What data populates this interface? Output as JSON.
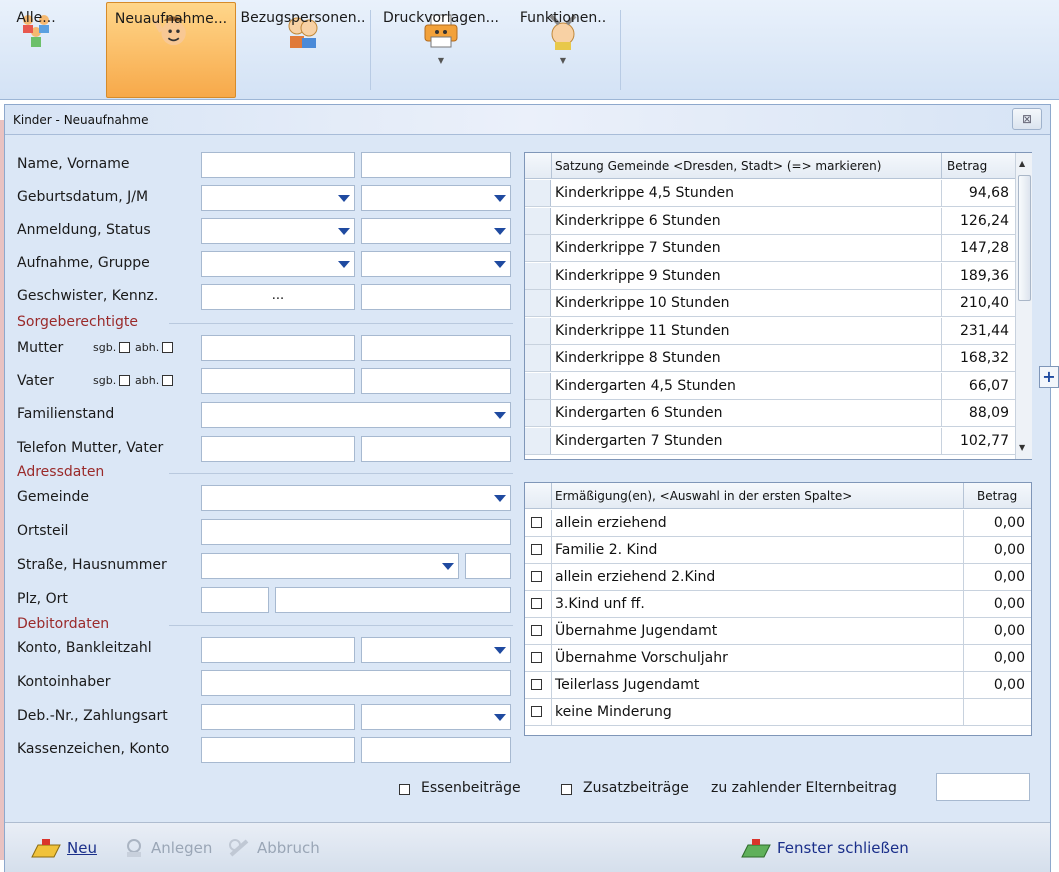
{
  "ribbon": {
    "buttons": [
      {
        "label": "Alle...",
        "icon": "children-group-icon"
      },
      {
        "label": "Neuaufnahme...",
        "icon": "child-waving-icon"
      },
      {
        "label": "Bezugspersonen..",
        "icon": "persons-icon"
      },
      {
        "label": "Druckvorlagen...",
        "icon": "printer-icon"
      },
      {
        "label": "Funktionen..",
        "icon": "tools-icon"
      }
    ]
  },
  "window": {
    "title": "Kinder - Neuaufnahme",
    "close_label": "⊠"
  },
  "form": {
    "labels": {
      "name": "Name, Vorname",
      "geburtsdatum": "Geburtsdatum, J/M",
      "anmeldung": "Anmeldung, Status",
      "aufnahme": "Aufnahme, Gruppe",
      "geschwister": "Geschwister, Kennz.",
      "mutter": "Mutter",
      "vater": "Vater",
      "familienstand": "Familienstand",
      "telefon": "Telefon Mutter, Vater",
      "gemeinde": "Gemeinde",
      "ortsteil": "Ortsteil",
      "strasse": "Straße, Hausnummer",
      "plz": "Plz, Ort",
      "konto": "Konto, Bankleitzahl",
      "kontoinhaber": "Kontoinhaber",
      "debnr": "Deb.-Nr., Zahlungsart",
      "kassenzeichen": "Kassenzeichen, Konto"
    },
    "sections": {
      "sorge": "Sorgeberechtigte",
      "adress": "Adressdaten",
      "debitor": "Debitordaten"
    },
    "sgb": "sgb.",
    "abh": "abh.",
    "ellipsis": "..."
  },
  "satzung": {
    "header_name": "Satzung Gemeinde <Dresden, Stadt> (=> markieren)",
    "header_value": "Betrag",
    "rows": [
      {
        "name": "Kinderkrippe 4,5 Stunden",
        "value": "94,68"
      },
      {
        "name": "Kinderkrippe 6 Stunden",
        "value": "126,24"
      },
      {
        "name": "Kinderkrippe 7 Stunden",
        "value": "147,28"
      },
      {
        "name": "Kinderkrippe 9 Stunden",
        "value": "189,36"
      },
      {
        "name": "Kinderkrippe 10 Stunden",
        "value": "210,40"
      },
      {
        "name": "Kinderkrippe 11 Stunden",
        "value": "231,44"
      },
      {
        "name": "Kinderkrippe 8 Stunden",
        "value": "168,32"
      },
      {
        "name": "Kindergarten 4,5 Stunden",
        "value": "66,07"
      },
      {
        "name": "Kindergarten 6 Stunden",
        "value": "88,09"
      },
      {
        "name": "Kindergarten 7 Stunden",
        "value": "102,77"
      }
    ],
    "plus": "+"
  },
  "ermaessigung": {
    "header_name": "Ermäßigung(en), <Auswahl in der ersten Spalte>",
    "header_value": "Betrag",
    "rows": [
      {
        "name": "allein erziehend",
        "value": "0,00"
      },
      {
        "name": "Familie 2. Kind",
        "value": "0,00"
      },
      {
        "name": "allein erziehend 2.Kind",
        "value": "0,00"
      },
      {
        "name": "3.Kind unf ff.",
        "value": "0,00"
      },
      {
        "name": "Übernahme Jugendamt",
        "value": "0,00"
      },
      {
        "name": "Übernahme Vorschuljahr",
        "value": "0,00"
      },
      {
        "name": "Teilerlass Jugendamt",
        "value": "0,00"
      },
      {
        "name": "keine Minderung",
        "value": ""
      }
    ]
  },
  "footer_options": {
    "essen": "Essenbeiträge",
    "zusatz": "Zusatzbeiträge",
    "eltern": "zu zahlender Elternbeitrag"
  },
  "bottom": {
    "neu": "Neu",
    "anlegen": "Anlegen",
    "abbruch": "Abbruch",
    "schliessen": "Fenster schließen"
  }
}
